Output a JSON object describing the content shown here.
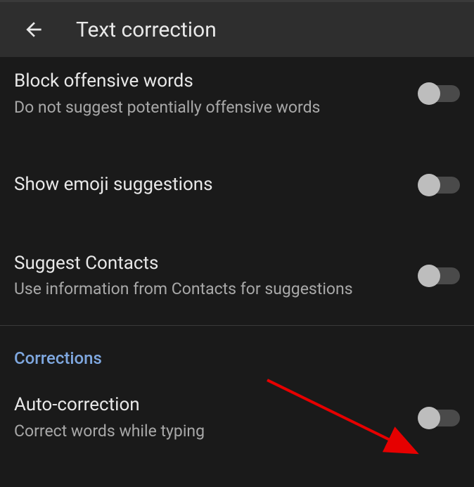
{
  "header": {
    "title": "Text correction"
  },
  "settings": {
    "block_offensive": {
      "title": "Block offensive words",
      "description": "Do not suggest potentially offensive words"
    },
    "emoji_suggestions": {
      "title": "Show emoji suggestions"
    },
    "suggest_contacts": {
      "title": "Suggest Contacts",
      "description": "Use information from Contacts for suggestions"
    },
    "auto_correction": {
      "title": "Auto-correction",
      "description": "Correct words while typing"
    }
  },
  "sections": {
    "corrections": "Corrections"
  }
}
